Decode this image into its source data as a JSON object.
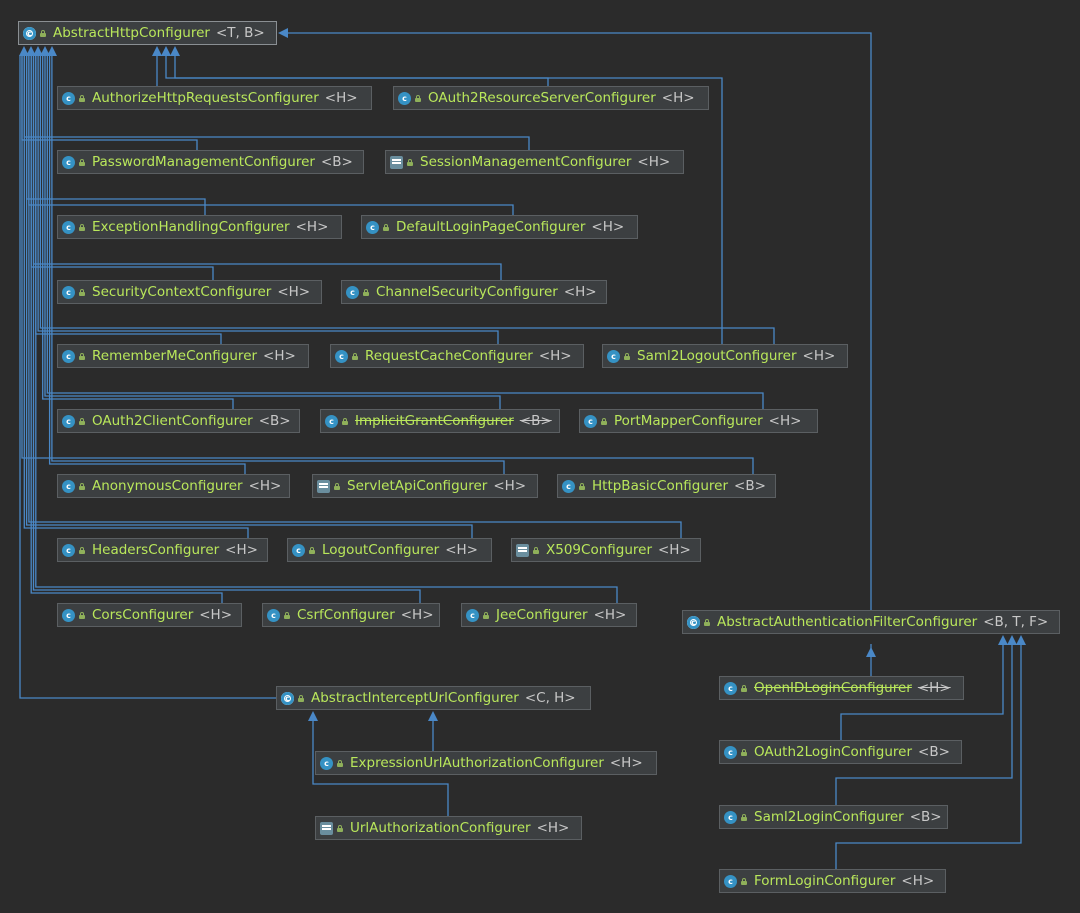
{
  "nodes": [
    {
      "key": "root",
      "name": "AbstractHttpConfigurer",
      "type": "<T, B>",
      "icon": "abstract-class-icon"
    },
    {
      "key": "authz",
      "name": "AuthorizeHttpRequestsConfigurer",
      "type": "<H>",
      "icon": "class-icon"
    },
    {
      "key": "oauth2rs",
      "name": "OAuth2ResourceServerConfigurer",
      "type": "<H>",
      "icon": "class-icon"
    },
    {
      "key": "pwd",
      "name": "PasswordManagementConfigurer",
      "type": "<B>",
      "icon": "class-icon"
    },
    {
      "key": "session",
      "name": "SessionManagementConfigurer",
      "type": "<H>",
      "icon": "final-class-icon"
    },
    {
      "key": "exc",
      "name": "ExceptionHandlingConfigurer",
      "type": "<H>",
      "icon": "class-icon"
    },
    {
      "key": "deflogin",
      "name": "DefaultLoginPageConfigurer",
      "type": "<H>",
      "icon": "class-icon"
    },
    {
      "key": "secctx",
      "name": "SecurityContextConfigurer",
      "type": "<H>",
      "icon": "class-icon"
    },
    {
      "key": "channel",
      "name": "ChannelSecurityConfigurer",
      "type": "<H>",
      "icon": "class-icon"
    },
    {
      "key": "remember",
      "name": "RememberMeConfigurer",
      "type": "<H>",
      "icon": "class-icon"
    },
    {
      "key": "reqcache",
      "name": "RequestCacheConfigurer",
      "type": "<H>",
      "icon": "class-icon"
    },
    {
      "key": "saml2logout",
      "name": "Saml2LogoutConfigurer",
      "type": "<H>",
      "icon": "class-icon"
    },
    {
      "key": "oauth2client",
      "name": "OAuth2ClientConfigurer",
      "type": "<B>",
      "icon": "class-icon"
    },
    {
      "key": "implicit",
      "name": "ImplicitGrantConfigurer",
      "type": "<B>",
      "icon": "class-icon",
      "deprecated": true
    },
    {
      "key": "portmap",
      "name": "PortMapperConfigurer",
      "type": "<H>",
      "icon": "class-icon"
    },
    {
      "key": "anon",
      "name": "AnonymousConfigurer",
      "type": "<H>",
      "icon": "class-icon"
    },
    {
      "key": "servlet",
      "name": "ServletApiConfigurer",
      "type": "<H>",
      "icon": "final-class-icon"
    },
    {
      "key": "httpbasic",
      "name": "HttpBasicConfigurer",
      "type": "<B>",
      "icon": "class-icon"
    },
    {
      "key": "headers",
      "name": "HeadersConfigurer",
      "type": "<H>",
      "icon": "class-icon"
    },
    {
      "key": "logout",
      "name": "LogoutConfigurer",
      "type": "<H>",
      "icon": "class-icon"
    },
    {
      "key": "x509",
      "name": "X509Configurer",
      "type": "<H>",
      "icon": "final-class-icon"
    },
    {
      "key": "cors",
      "name": "CorsConfigurer",
      "type": "<H>",
      "icon": "class-icon"
    },
    {
      "key": "csrf",
      "name": "CsrfConfigurer",
      "type": "<H>",
      "icon": "class-icon"
    },
    {
      "key": "jee",
      "name": "JeeConfigurer",
      "type": "<H>",
      "icon": "class-icon"
    },
    {
      "key": "absauth",
      "name": "AbstractAuthenticationFilterConfigurer",
      "type": "<B, T, F>",
      "icon": "abstract-class-icon"
    },
    {
      "key": "openid",
      "name": "OpenIDLoginConfigurer",
      "type": "<H>",
      "icon": "class-icon",
      "deprecated": true
    },
    {
      "key": "oauth2login",
      "name": "OAuth2LoginConfigurer",
      "type": "<B>",
      "icon": "class-icon"
    },
    {
      "key": "saml2login",
      "name": "Saml2LoginConfigurer",
      "type": "<B>",
      "icon": "class-icon"
    },
    {
      "key": "formlogin",
      "name": "FormLoginConfigurer",
      "type": "<H>",
      "icon": "class-icon"
    },
    {
      "key": "absintercept",
      "name": "AbstractInterceptUrlConfigurer",
      "type": "<C, H>",
      "icon": "abstract-class-icon"
    },
    {
      "key": "exprurl",
      "name": "ExpressionUrlAuthorizationConfigurer",
      "type": "<H>",
      "icon": "class-icon"
    },
    {
      "key": "urlauth",
      "name": "UrlAuthorizationConfigurer",
      "type": "<H>",
      "icon": "final-class-icon"
    }
  ],
  "edges": [
    [
      "authz",
      "root"
    ],
    [
      "oauth2rs",
      "root"
    ],
    [
      "pwd",
      "root"
    ],
    [
      "session",
      "root"
    ],
    [
      "exc",
      "root"
    ],
    [
      "deflogin",
      "root"
    ],
    [
      "secctx",
      "root"
    ],
    [
      "channel",
      "root"
    ],
    [
      "remember",
      "root"
    ],
    [
      "reqcache",
      "root"
    ],
    [
      "saml2logout",
      "root"
    ],
    [
      "oauth2client",
      "root"
    ],
    [
      "implicit",
      "root"
    ],
    [
      "portmap",
      "root"
    ],
    [
      "anon",
      "root"
    ],
    [
      "servlet",
      "root"
    ],
    [
      "httpbasic",
      "root"
    ],
    [
      "headers",
      "root"
    ],
    [
      "logout",
      "root"
    ],
    [
      "x509",
      "root"
    ],
    [
      "cors",
      "root"
    ],
    [
      "csrf",
      "root"
    ],
    [
      "jee",
      "root"
    ],
    [
      "absintercept",
      "root"
    ],
    [
      "absauth",
      "root"
    ],
    [
      "openid",
      "absauth"
    ],
    [
      "oauth2login",
      "absauth"
    ],
    [
      "saml2login",
      "absauth"
    ],
    [
      "formlogin",
      "absauth"
    ],
    [
      "exprurl",
      "absintercept"
    ],
    [
      "urlauth",
      "exprurl"
    ]
  ],
  "colors": {
    "edge": "#4a88c7",
    "background": "#2b2b2b",
    "name": "#b9e75b",
    "type": "#c8c8c8"
  }
}
